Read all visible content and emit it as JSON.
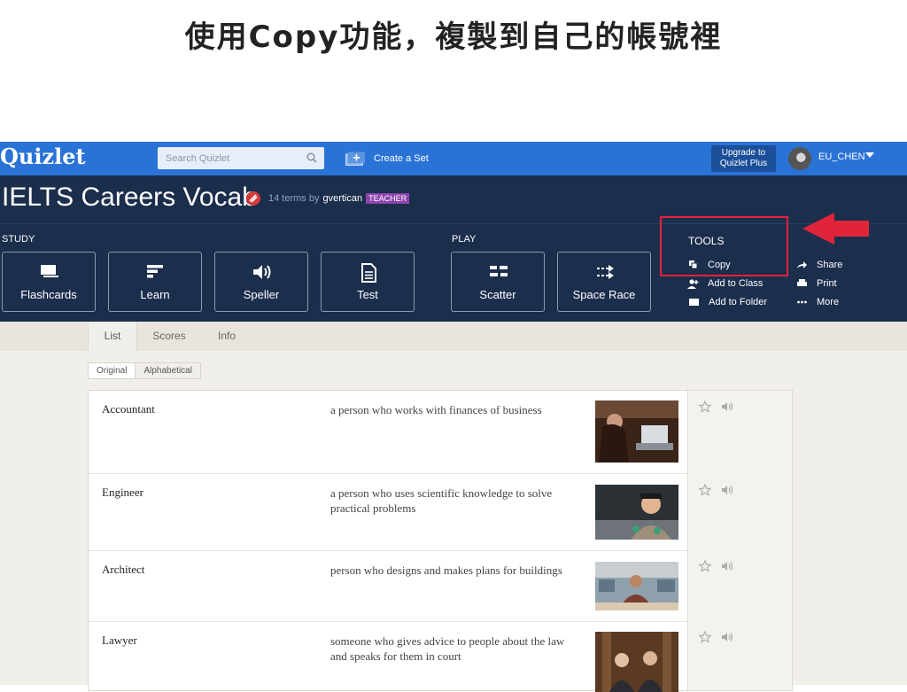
{
  "caption": "使用Copy功能，複製到自己的帳號裡",
  "topbar": {
    "logo": "Quizlet",
    "search_placeholder": "Search Quizlet",
    "create_label": "Create a Set",
    "upgrade_line1": "Upgrade to",
    "upgrade_line2": "Quizlet Plus",
    "username": "EU_CHEN",
    "bar_color": "#2a73d6"
  },
  "set": {
    "title": "IELTS Careers Vocab",
    "meta_terms": "14 terms by",
    "author": "gvertican",
    "badge": "TEACHER",
    "header_color": "#1b2e4c"
  },
  "study": {
    "label": "STUDY",
    "modes": [
      {
        "label": "Flashcards",
        "icon": "flashcards-icon"
      },
      {
        "label": "Learn",
        "icon": "learn-icon"
      },
      {
        "label": "Speller",
        "icon": "speaker-icon"
      },
      {
        "label": "Test",
        "icon": "document-icon"
      }
    ]
  },
  "play": {
    "label": "PLAY",
    "modes": [
      {
        "label": "Scatter",
        "icon": "scatter-icon"
      },
      {
        "label": "Space Race",
        "icon": "arrows-icon"
      }
    ]
  },
  "tools": {
    "title": "TOOLS",
    "items": [
      {
        "label": "Copy",
        "icon": "copy-icon"
      },
      {
        "label": "Add to Class",
        "icon": "add-user-icon"
      },
      {
        "label": "Add to Folder",
        "icon": "folder-icon"
      },
      {
        "label": "Share",
        "icon": "share-icon"
      },
      {
        "label": "Print",
        "icon": "print-icon"
      },
      {
        "label": "More",
        "icon": "more-icon"
      }
    ],
    "highlight_color": "#e0243a"
  },
  "tabs": [
    {
      "label": "List",
      "active": true
    },
    {
      "label": "Scores",
      "active": false
    },
    {
      "label": "Info",
      "active": false
    }
  ],
  "sort": {
    "option1": "Original",
    "option2": "Alphabetical"
  },
  "terms": [
    {
      "word": "Accountant",
      "definition": "a person who works with finances of business"
    },
    {
      "word": "Engineer",
      "definition": "a person who uses scientific knowledge to solve practical problems"
    },
    {
      "word": "Architect",
      "definition": "person who designs and makes plans for buildings"
    },
    {
      "word": "Lawyer",
      "definition": "someone who gives advice to people about the law and speaks for them in court"
    }
  ]
}
